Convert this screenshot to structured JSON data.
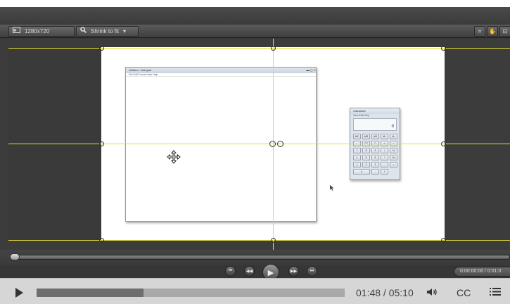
{
  "toolbar": {
    "dimensions_label": "1280x720",
    "zoom_label": "Shrink to fit"
  },
  "canvas": {
    "notepad": {
      "title": "Untitled - Notepad",
      "menu": "File  Edit  Format  View  Help"
    },
    "calculator": {
      "title": "Calculator",
      "menu": "View  Edit  Help",
      "display": "0",
      "keys": [
        "MC",
        "MR",
        "MS",
        "M+",
        "M-",
        "←",
        "CE",
        "C",
        "±",
        "√",
        "7",
        "8",
        "9",
        "/",
        "%",
        "4",
        "5",
        "6",
        "*",
        "1/x",
        "1",
        "2",
        "3",
        "-",
        "=",
        "0",
        "",
        ".",
        "+",
        ""
      ]
    }
  },
  "scrubber": {
    "position_fraction": 0.02
  },
  "transport": {
    "timecode": "0:00:00:00 / 0:01:0"
  },
  "player": {
    "time": "01:48 / 05:10",
    "cc_label": "CC",
    "progress_fraction": 0.348
  },
  "colors": {
    "guide": "#e5e22a",
    "stage": "#ffffff",
    "chrome": "#3a3a3a"
  }
}
